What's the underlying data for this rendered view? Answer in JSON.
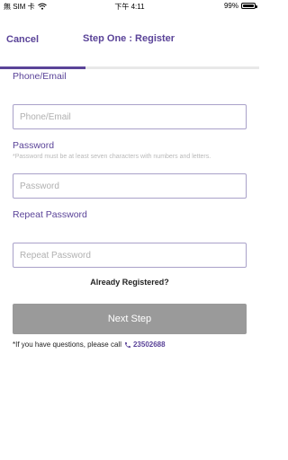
{
  "status_bar": {
    "carrier": "無 SIM 卡",
    "time": "下午 4:11",
    "battery": "99%",
    "battery_level": 0.99
  },
  "nav": {
    "cancel_label": "Cancel",
    "title": "Step One : Register",
    "step_progress": 0.33
  },
  "form": {
    "phone_label": "Phone/Email",
    "phone_placeholder": "Phone/Email",
    "phone_value": "",
    "password_label": "Password",
    "password_hint": "*Password must be at least seven characters with numbers and letters.",
    "password_placeholder": "Password",
    "password_value": "",
    "repeat_label": "Repeat Password",
    "repeat_placeholder": "Repeat Password",
    "repeat_value": ""
  },
  "already_registered": "Already Registered?",
  "next_button": "Next Step",
  "footer": {
    "text": "*If you have questions, please call",
    "phone_icon": "phone-icon",
    "phone_number": "23502688"
  },
  "colors": {
    "accent": "#5a4398",
    "button_disabled": "#9a9a9a",
    "input_border": "#a9a1c9"
  }
}
